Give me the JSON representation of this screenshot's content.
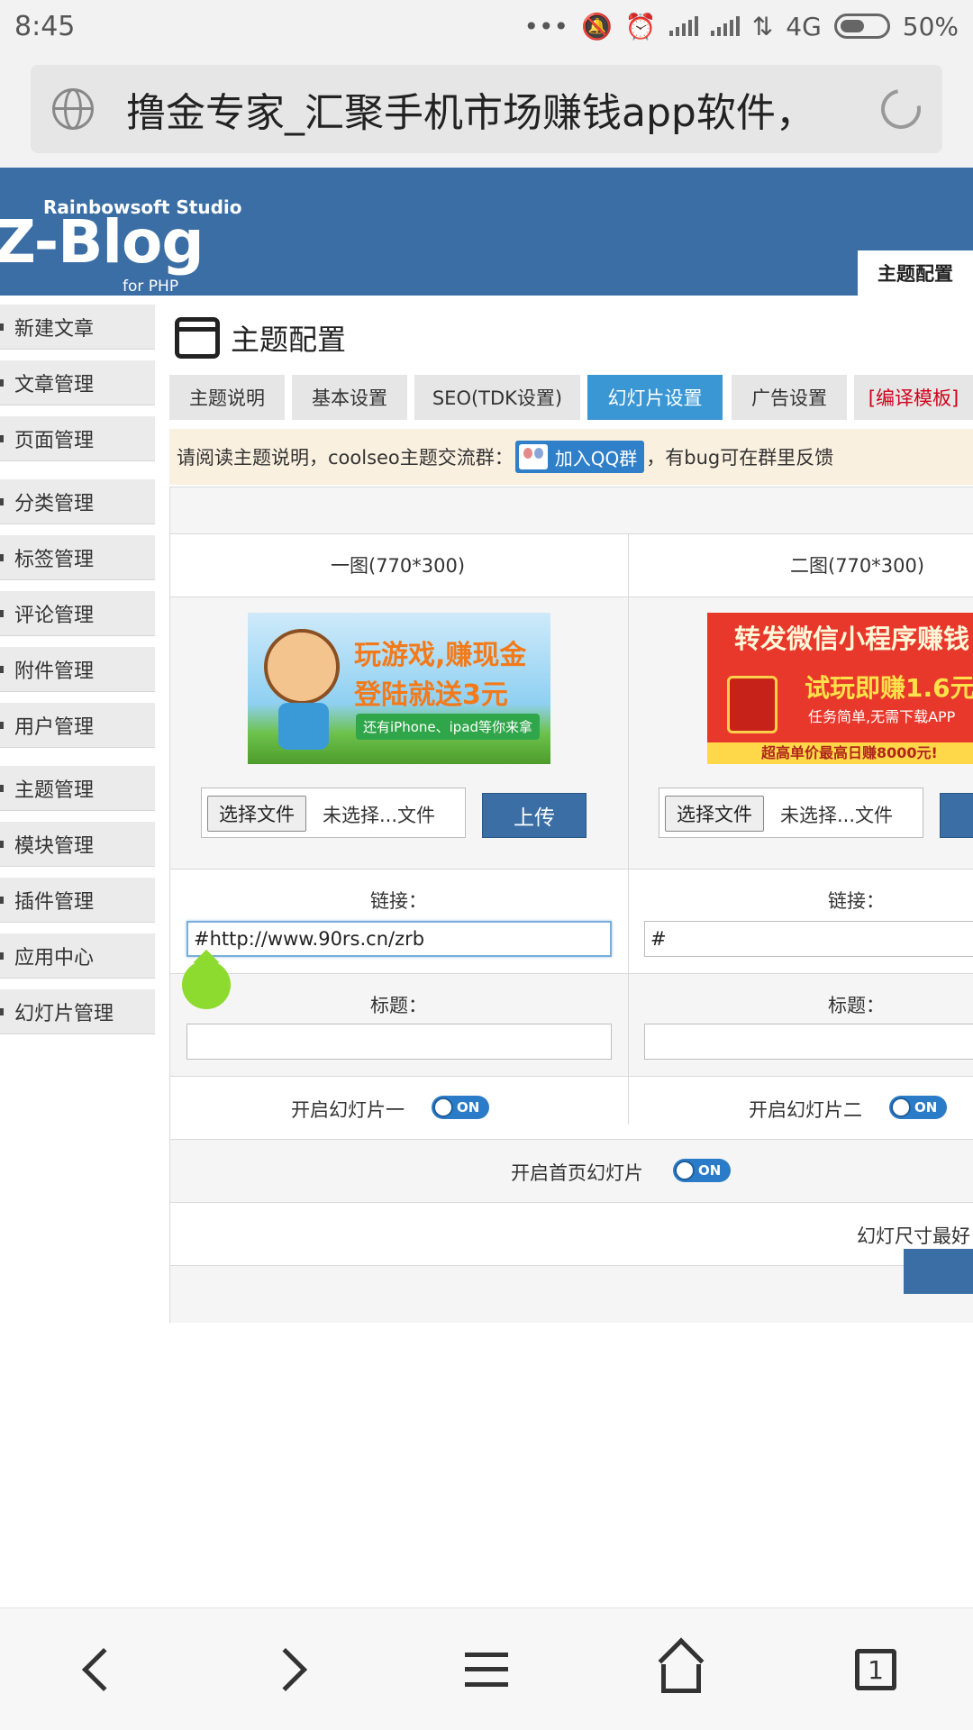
{
  "status_bar": {
    "time": "8:45",
    "network": "4G",
    "battery": "50%"
  },
  "browser": {
    "page_title": "撸金专家_汇聚手机市场赚钱app软件，",
    "tab_count": "1"
  },
  "header": {
    "logo_studio": "Rainbowsoft Studio",
    "logo_name": "Z-Blog",
    "logo_sub": "for PHP",
    "active_tab": "主题配置"
  },
  "sidebar": {
    "items": [
      {
        "label": "新建文章"
      },
      {
        "label": "文章管理"
      },
      {
        "label": "页面管理"
      },
      {
        "label": "分类管理"
      },
      {
        "label": "标签管理"
      },
      {
        "label": "评论管理"
      },
      {
        "label": "附件管理"
      },
      {
        "label": "用户管理"
      },
      {
        "label": "主题管理"
      },
      {
        "label": "模块管理"
      },
      {
        "label": "插件管理"
      },
      {
        "label": "应用中心"
      },
      {
        "label": "幻灯片管理"
      }
    ]
  },
  "main": {
    "title": "主题配置",
    "tabs": [
      {
        "label": "主题说明"
      },
      {
        "label": "基本设置"
      },
      {
        "label": "SEO(TDK设置)"
      },
      {
        "label": "幻灯片设置"
      },
      {
        "label": "广告设置"
      },
      {
        "label": "[编译模板]"
      }
    ],
    "notice_prefix": "请阅读主题说明，coolseo主题交流群：",
    "qq_button": "加入QQ群",
    "notice_suffix": "，有bug可在群里反馈",
    "slides": [
      {
        "header": "一图(770*300)",
        "banner_line1": "玩游戏,赚现金",
        "banner_line2": "登陆就送3元",
        "banner_line3": "还有iPhone、ipad等你来拿",
        "choose_file": "选择文件",
        "file_name": "未选择...文件",
        "upload": "上传",
        "link_label": "链接：",
        "link_value": "#http://www.90rs.cn/zrb",
        "title_label": "标题：",
        "title_value": "",
        "toggle_label": "开启幻灯片一",
        "toggle_state": "ON"
      },
      {
        "header": "二图(770*300)",
        "banner_line1": "转发微信小程序赚钱",
        "banner_line2": "试玩即赚1.6元",
        "banner_line3": "任务简单,无需下载APP",
        "banner_line4": "超高单价最高日赚8000元!",
        "choose_file": "选择文件",
        "file_name": "未选择...文件",
        "link_label": "链接：",
        "link_value": "#",
        "title_label": "标题：",
        "title_value": "",
        "toggle_label": "开启幻灯片二",
        "toggle_state": "ON"
      }
    ],
    "home_toggle_label": "开启首页幻灯片",
    "home_toggle_state": "ON",
    "size_note": "幻灯尺寸最好"
  },
  "colors": {
    "header_blue": "#3a6ea5",
    "active_tab": "#3a97d4",
    "notice_bg": "#faf0df",
    "compile_red": "#d0021b"
  }
}
